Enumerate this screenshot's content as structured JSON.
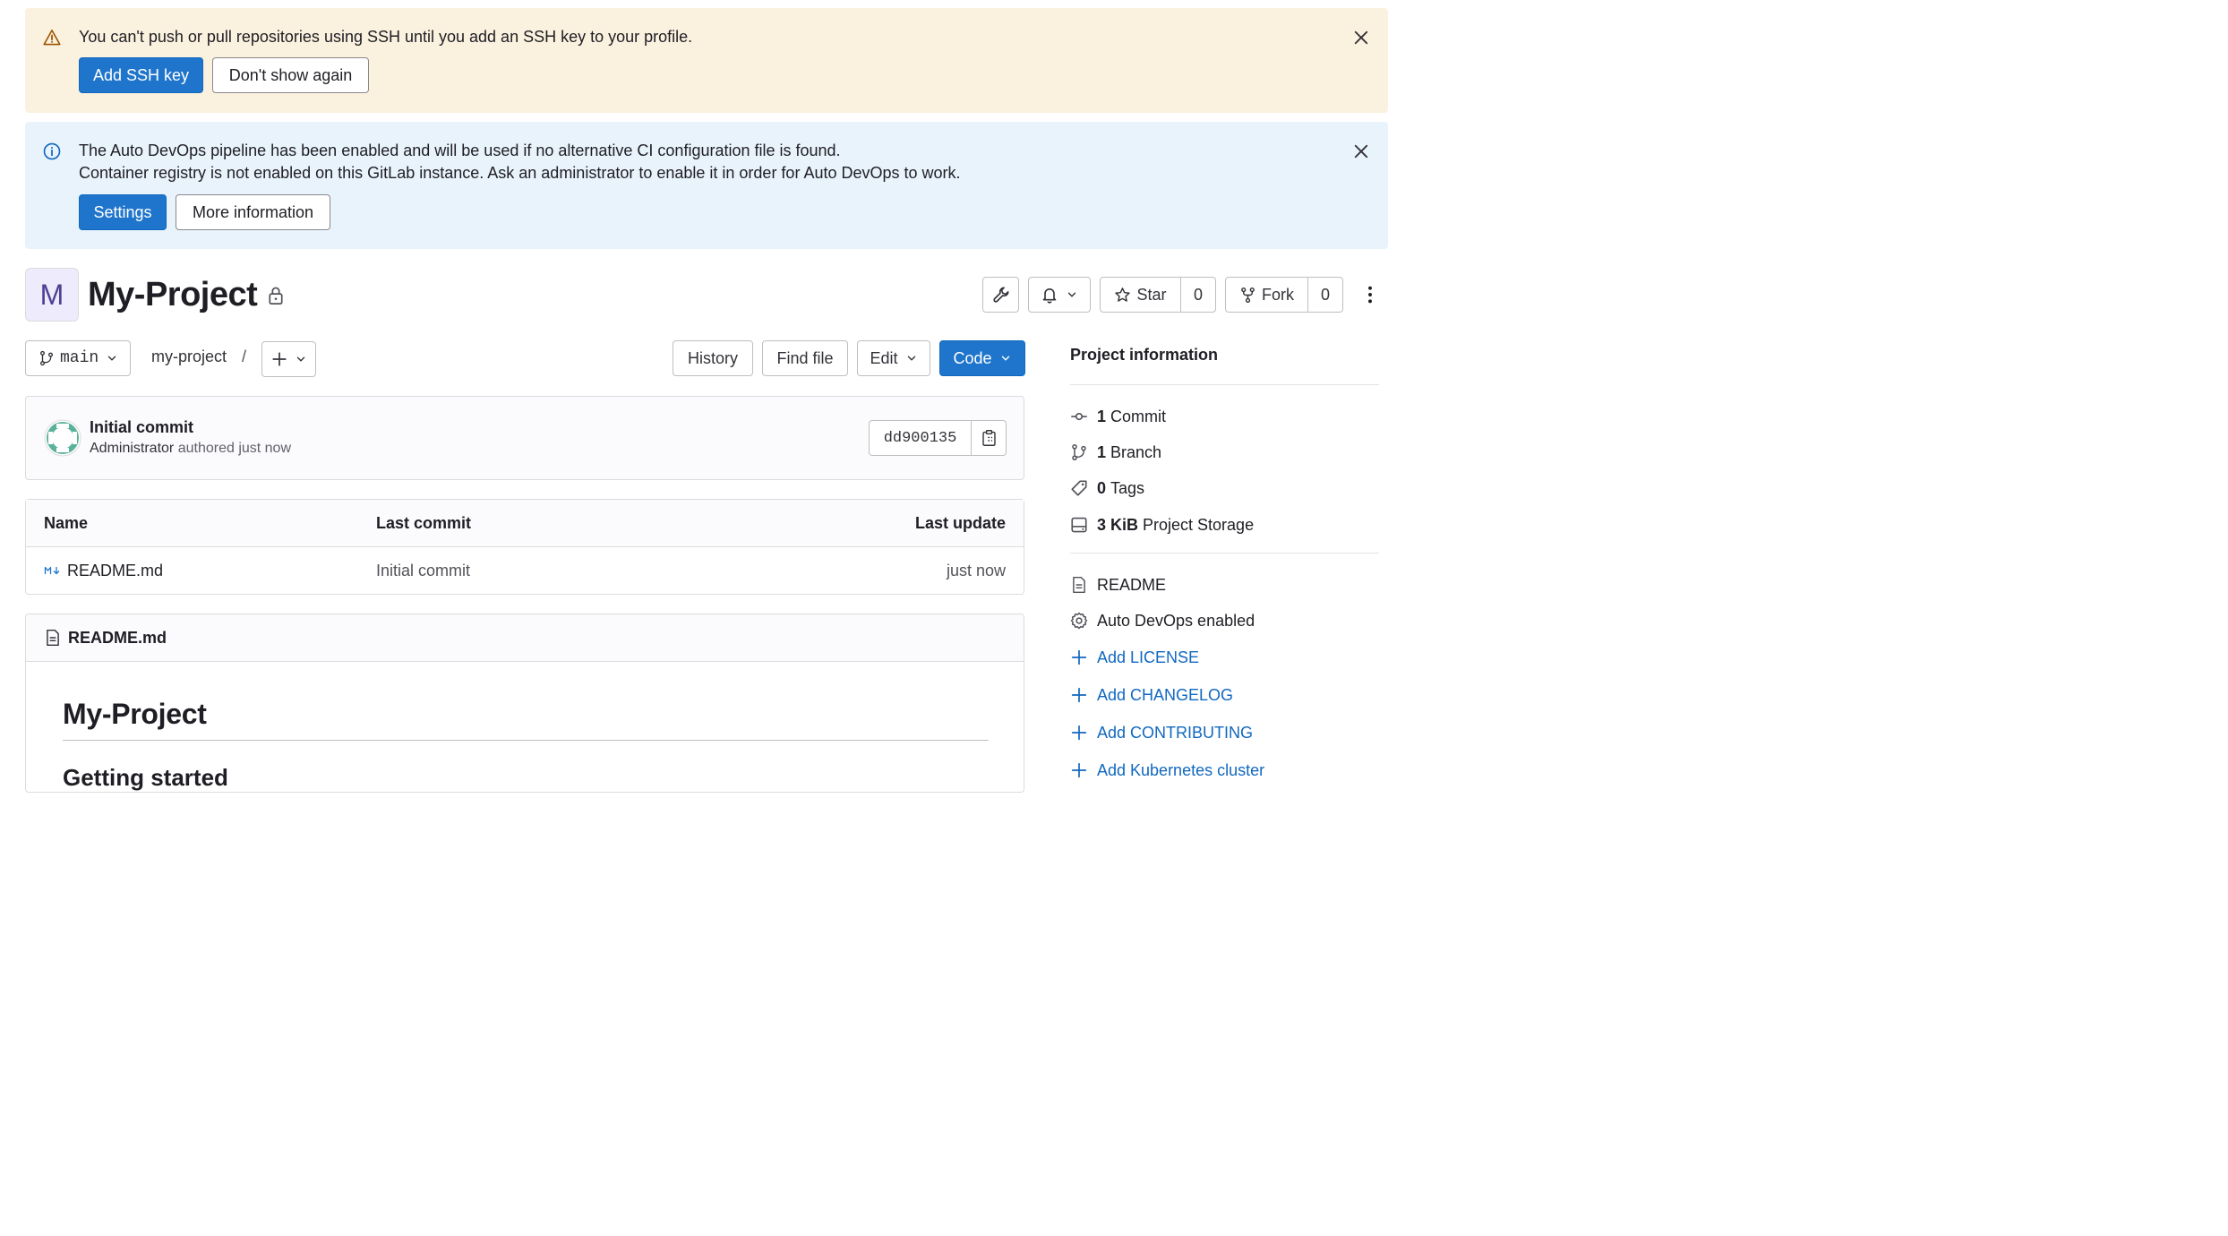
{
  "ssh_alert": {
    "message": "You can't push or pull repositories using SSH until you add an SSH key to your profile.",
    "primary_label": "Add SSH key",
    "secondary_label": "Don't show again"
  },
  "devops_alert": {
    "line1": "The Auto DevOps pipeline has been enabled and will be used if no alternative CI configuration file is found.",
    "line2": "Container registry is not enabled on this GitLab instance. Ask an administrator to enable it in order for Auto DevOps to work.",
    "primary_label": "Settings",
    "secondary_label": "More information"
  },
  "project": {
    "avatar_letter": "M",
    "title": "My-Project",
    "star_label": "Star",
    "star_count": "0",
    "fork_label": "Fork",
    "fork_count": "0"
  },
  "repo_bar": {
    "branch": "main",
    "path": "my-project",
    "slash": "/",
    "history_label": "History",
    "find_file_label": "Find file",
    "edit_label": "Edit",
    "code_label": "Code"
  },
  "last_commit": {
    "title": "Initial commit",
    "author": "Administrator",
    "meta": "authored just now",
    "sha": "dd900135"
  },
  "file_table": {
    "headers": {
      "name": "Name",
      "last_commit": "Last commit",
      "last_update": "Last update"
    },
    "rows": [
      {
        "name": "README.md",
        "commit": "Initial commit",
        "updated": "just now"
      }
    ]
  },
  "readme": {
    "filename": "README.md",
    "h1": "My-Project",
    "h2": "Getting started"
  },
  "sidebar": {
    "title": "Project information",
    "stats": [
      {
        "count": "1",
        "label": "Commit",
        "icon": "commit-icon"
      },
      {
        "count": "1",
        "label": "Branch",
        "icon": "branch-icon"
      },
      {
        "count": "0",
        "label": "Tags",
        "icon": "tag-icon"
      },
      {
        "count": "3 KiB",
        "label": "Project Storage",
        "icon": "storage-icon"
      }
    ],
    "links": [
      {
        "label": "README",
        "icon": "document-icon"
      },
      {
        "label": "Auto DevOps enabled",
        "icon": "gear-icon"
      },
      {
        "label": "Add LICENSE",
        "icon": "plus-icon"
      },
      {
        "label": "Add CHANGELOG",
        "icon": "plus-icon"
      },
      {
        "label": "Add CONTRIBUTING",
        "icon": "plus-icon"
      },
      {
        "label": "Add Kubernetes cluster",
        "icon": "plus-icon"
      }
    ]
  },
  "colors": {
    "primary": "#1f75cb",
    "warning_bg": "#fbf1df",
    "info_bg": "#e9f3fc",
    "link": "#1068bf"
  }
}
